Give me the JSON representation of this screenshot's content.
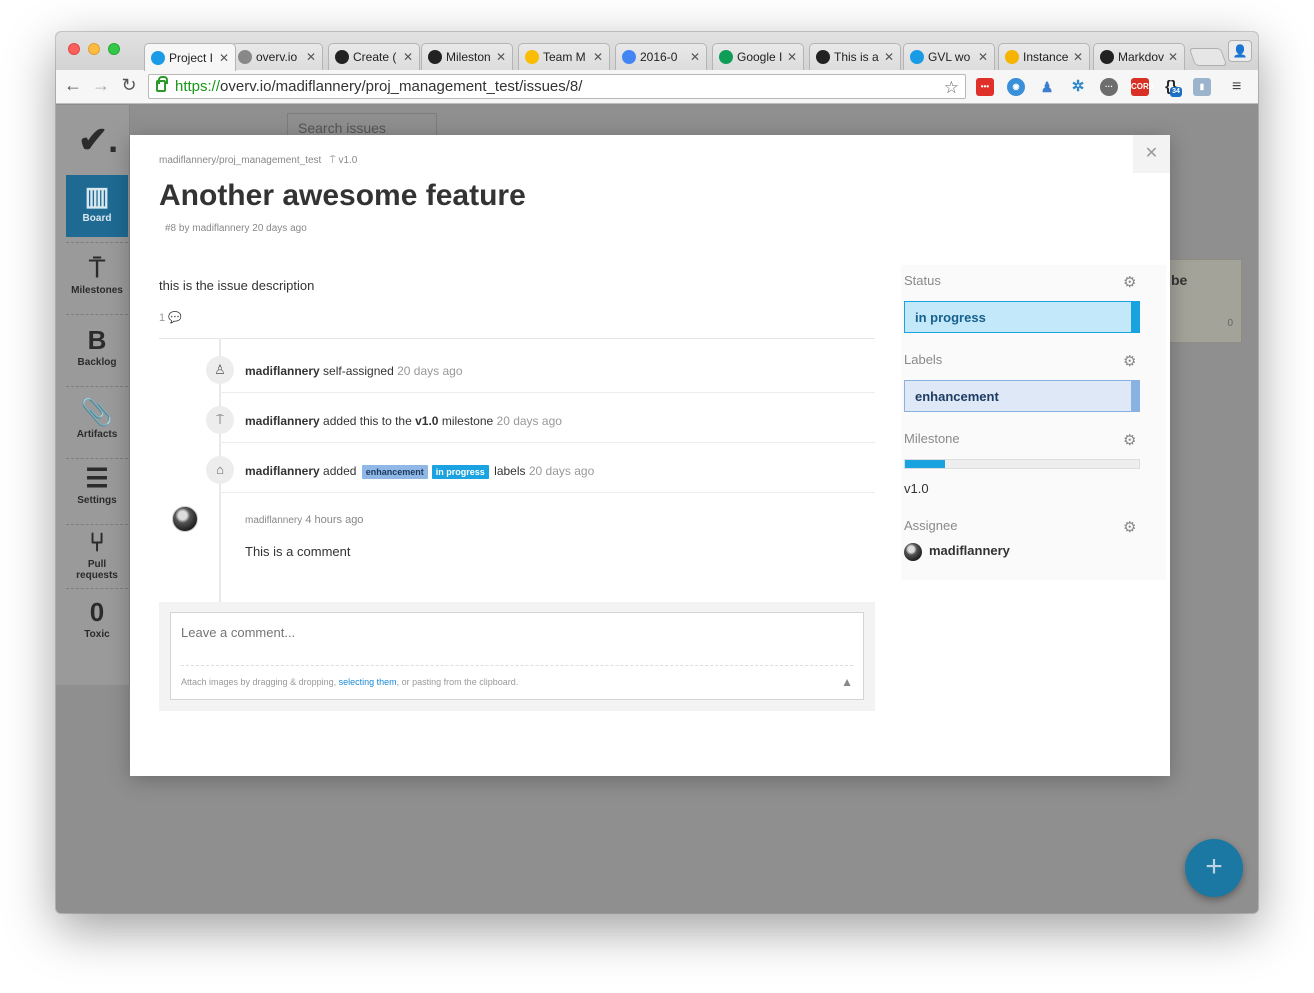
{
  "browser": {
    "tabs": [
      {
        "label": "Project I",
        "icon": "check-circle-icon",
        "color": "#1a9be6",
        "active": true
      },
      {
        "label": "overv.io",
        "icon": "page-icon",
        "color": "#888888"
      },
      {
        "label": "Create (",
        "icon": "github-icon",
        "color": "#222222"
      },
      {
        "label": "Mileston",
        "icon": "github-icon",
        "color": "#222222"
      },
      {
        "label": "Team M",
        "icon": "google-drive-icon",
        "color": "#fbbc04"
      },
      {
        "label": "2016-0",
        "icon": "google-docs-icon",
        "color": "#4285f4"
      },
      {
        "label": "Google I",
        "icon": "hangouts-icon",
        "color": "#0f9d58"
      },
      {
        "label": "This is a",
        "icon": "github-icon",
        "color": "#222222"
      },
      {
        "label": "GVL wo",
        "icon": "check-circle-icon",
        "color": "#1a9be6"
      },
      {
        "label": "Instance",
        "icon": "cluster-icon",
        "color": "#f4b400"
      },
      {
        "label": "Markdov",
        "icon": "github-icon",
        "color": "#222222"
      }
    ],
    "url_scheme": "https://",
    "url_rest": "overv.io/madiflannery/proj_management_test/issues/8/",
    "extension_badge": "34"
  },
  "app": {
    "search_placeholder": "Search issues",
    "sidebar": [
      {
        "label": "Board",
        "icon": "board-icon",
        "glyph": "▥"
      },
      {
        "label": "Milestones",
        "icon": "signpost-icon",
        "glyph": "⍑"
      },
      {
        "label": "Backlog",
        "icon": "backlog-icon",
        "glyph": "B"
      },
      {
        "label": "Artifacts",
        "icon": "paperclip-icon",
        "glyph": "📎"
      },
      {
        "label": "Settings",
        "icon": "sliders-icon",
        "glyph": "☰"
      },
      {
        "label": "Pull requests",
        "icon": "pull-request-icon",
        "glyph": "⑂"
      },
      {
        "label": "Toxic",
        "icon": "toxic-count-icon",
        "glyph": "0"
      }
    ],
    "bg_card_text": "be",
    "bg_card_count": "0"
  },
  "modal": {
    "repo": "madiflannery/proj_management_test",
    "milestone_tag": "v1.0",
    "title": "Another awesome feature",
    "meta": "#8 by madiflannery 20 days ago",
    "description": "this is the issue description",
    "comment_count": "1",
    "events": [
      {
        "user": "madiflannery",
        "action": "self-assigned",
        "time": "20 days ago",
        "icon": "assignee-icon"
      },
      {
        "user": "madiflannery",
        "action_pre": "added this to the",
        "milestone": "v1.0",
        "action_post": "milestone",
        "time": "20 days ago",
        "icon": "milestone-icon"
      },
      {
        "user": "madiflannery",
        "action_pre": "added",
        "labels": [
          "enhancement",
          "in progress"
        ],
        "action_post": "labels",
        "time": "20 days ago",
        "icon": "tag-icon"
      }
    ],
    "comment": {
      "user": "madiflannery",
      "time": "4 hours ago",
      "body": "This is a comment"
    },
    "compose": {
      "placeholder": "Leave a comment...",
      "help_pre": "Attach images by dragging & dropping,",
      "help_link": "selecting them",
      "help_post": ", or pasting from the clipboard."
    },
    "sidebar": {
      "status_label": "Status",
      "status_value": "in progress",
      "labels_label": "Labels",
      "labels_value": "enhancement",
      "milestone_label": "Milestone",
      "milestone_progress": 0.17,
      "milestone_value": "v1.0",
      "assignee_label": "Assignee",
      "assignee_value": "madiflannery"
    }
  },
  "colors": {
    "accent": "#18a2df",
    "enhancement": "#89b2e3"
  }
}
